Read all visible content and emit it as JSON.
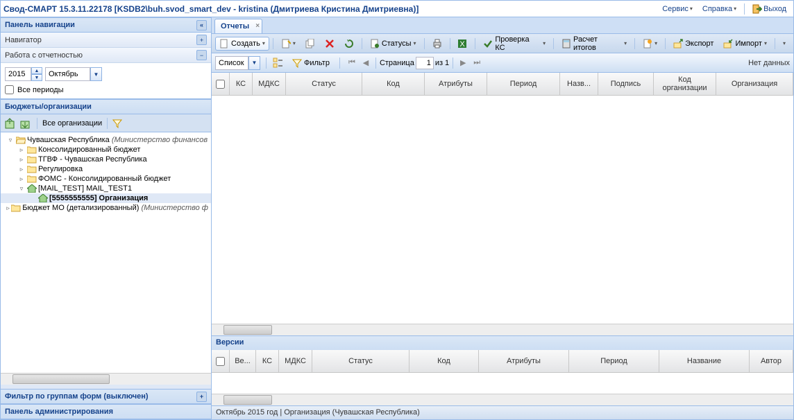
{
  "appTitle": "Свод-СМАРТ 15.3.11.22178 [KSDB2\\buh.svod_smart_dev - kristina (Дмитриева Кристина Дмитриевна)]",
  "topMenu": {
    "service": "Сервис",
    "help": "Справка",
    "exit": "Выход"
  },
  "nav": {
    "panelTitle": "Панель навигации",
    "navigator": "Навигатор",
    "reportWork": "Работа с отчетностью",
    "year": "2015",
    "month": "Октябрь",
    "allPeriods": "Все периоды",
    "budgetsOrgs": "Бюджеты/организации",
    "allOrgs": "Все организации",
    "tree": {
      "root": {
        "text": "Чувашская Республика ",
        "italic": "(Министерство финансов"
      },
      "c1": "Консолидированный бюджет",
      "c2": "ТГВФ - Чувашская Республика",
      "c3": "Регулировка",
      "c4": "ФОМС - Консолидированный бюджет",
      "c5": "[MAIL_TEST] MAIL_TEST1",
      "c6": "[5555555555] Организация",
      "c7": {
        "text": "Бюджет МО (детализированный) ",
        "italic": "(Министерство ф"
      }
    },
    "filterGroups": "Фильтр по группам форм (выключен)",
    "adminPanel": "Панель администрирования"
  },
  "tabs": {
    "reports": "Отчеты"
  },
  "toolbar": {
    "create": "Создать",
    "statuses": "Статусы",
    "checkKS": "Проверка КС",
    "calcTotals": "Расчет итогов",
    "export": "Экспорт",
    "import": "Импорт"
  },
  "subtoolbar": {
    "listMode": "Список",
    "filter": "Фильтр",
    "pageLabel": "Страница",
    "page": "1",
    "of": "из 1",
    "noData": "Нет данных"
  },
  "columns": {
    "c1": "КС",
    "c2": "МДКС",
    "c3": "Статус",
    "c4": "Код",
    "c5": "Атрибуты",
    "c6": "Период",
    "c7": "Назв...",
    "c8": "Подпись",
    "c9": "Код организации",
    "c10": "Организация"
  },
  "versions": {
    "title": "Версии",
    "v1": "Ве...",
    "v2": "КС",
    "v3": "МДКС",
    "v4": "Статус",
    "v5": "Код",
    "v6": "Атрибуты",
    "v7": "Период",
    "v8": "Название",
    "v9": "Автор"
  },
  "statusbar": "Октябрь 2015 год | Организация (Чувашская Республика)"
}
